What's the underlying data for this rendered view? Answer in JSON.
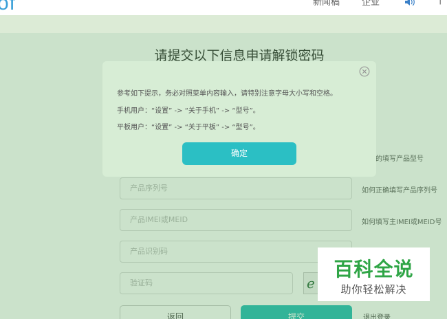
{
  "header": {
    "logo": "of",
    "nav": [
      "新闻稿",
      "企业"
    ]
  },
  "page": {
    "title": "请提交以下信息申请解锁密码",
    "fields": [
      {
        "placeholder": "产品序列号",
        "hint": "如何正确填写产品序列号"
      },
      {
        "placeholder": "产品IMEI或MEID",
        "hint": "如何填写主IMEI或MEID号"
      },
      {
        "placeholder": "产品识别码",
        "hint": ""
      }
    ],
    "model_hint": "正确的填写产品型号",
    "captcha_placeholder": "验证码",
    "captcha_text": "e",
    "back_label": "返回",
    "submit_label": "提交",
    "logout_label": "退出登录"
  },
  "modal": {
    "lines": [
      "参考如下提示，务必对照菜单内容输入，请特别注意字母大小写和空格。",
      "手机用户：“设置” -> “关于手机” -> “型号”。",
      "平板用户：“设置” -> “关于平板” -> “型号”。"
    ],
    "confirm_label": "确定"
  },
  "watermark": {
    "main": "百科全说",
    "sub": "助你轻松解决"
  },
  "colors": {
    "accent": "#2bbfc4",
    "modal_bg": "#d7edd5",
    "band": "#dcebd6",
    "watermark_green": "#2fa546"
  }
}
